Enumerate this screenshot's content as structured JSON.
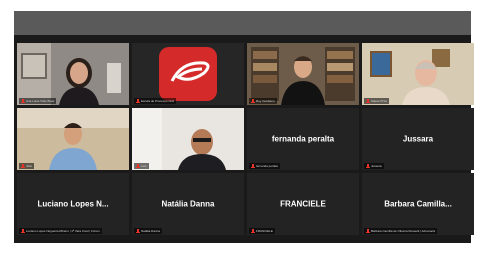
{
  "participants": [
    {
      "display_name": "",
      "caption": "Ana Luiza Vilas Boas",
      "video": true
    },
    {
      "display_name": "",
      "caption": "Escola de Processo Civil",
      "video": true
    },
    {
      "display_name": "",
      "caption": "Ruy Veridiano",
      "video": true,
      "speaking": true
    },
    {
      "display_name": "",
      "caption": "Salete Pinto",
      "video": true
    },
    {
      "display_name": "",
      "caption": "Júlio",
      "video": true
    },
    {
      "display_name": "",
      "caption": "Luis",
      "video": true
    },
    {
      "display_name": "fernanda peralta",
      "caption": "fernanda peralta",
      "video": false
    },
    {
      "display_name": "Jussara",
      "caption": "Jussara",
      "video": false
    },
    {
      "display_name": "Luciano Lopes N...",
      "caption": "Luciano Lopes Nogueira Ribeiro | 1ª Vara Cível | Fórum",
      "video": false
    },
    {
      "display_name": "Natália Danna",
      "caption": "Natália Danna",
      "video": false
    },
    {
      "display_name": "FRANCIELE",
      "caption": "FRANCIELE",
      "video": false
    },
    {
      "display_name": "Barbara Camilla...",
      "caption": "Barbara Camilla de Oliveira Rossetti | Advocacia",
      "video": false
    }
  ],
  "colors": {
    "active_speaker": "#7bd23a",
    "mute_icon": "#e5332a",
    "tile_bg": "#232323",
    "toolbar": "#5a5a5a"
  }
}
